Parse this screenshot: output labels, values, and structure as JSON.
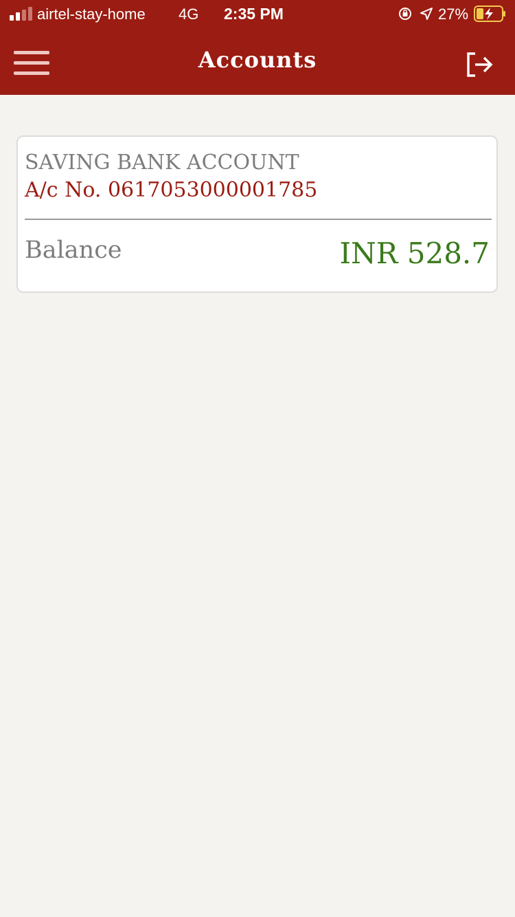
{
  "status_bar": {
    "carrier": "airtel-stay-home",
    "network": "4G",
    "time": "2:35 PM",
    "battery": "27%",
    "signal_icon": "signal-icon",
    "rotation_icon": "rotation-lock-icon",
    "location_icon": "location-arrow-icon",
    "battery_icon": "battery-charging-icon"
  },
  "header": {
    "title": "Accounts",
    "menu_icon": "hamburger-menu-icon",
    "logout_icon": "logout-icon"
  },
  "accounts": [
    {
      "type": "SAVING BANK ACCOUNT",
      "number": "A/c No. 0617053000001785",
      "balance_label": "Balance",
      "balance": "INR 528.7"
    }
  ],
  "colors": {
    "brand": "#9b1c12",
    "background": "#f4f3ef",
    "balance": "#3a7a1c",
    "muted_text": "#7d7d7d"
  }
}
